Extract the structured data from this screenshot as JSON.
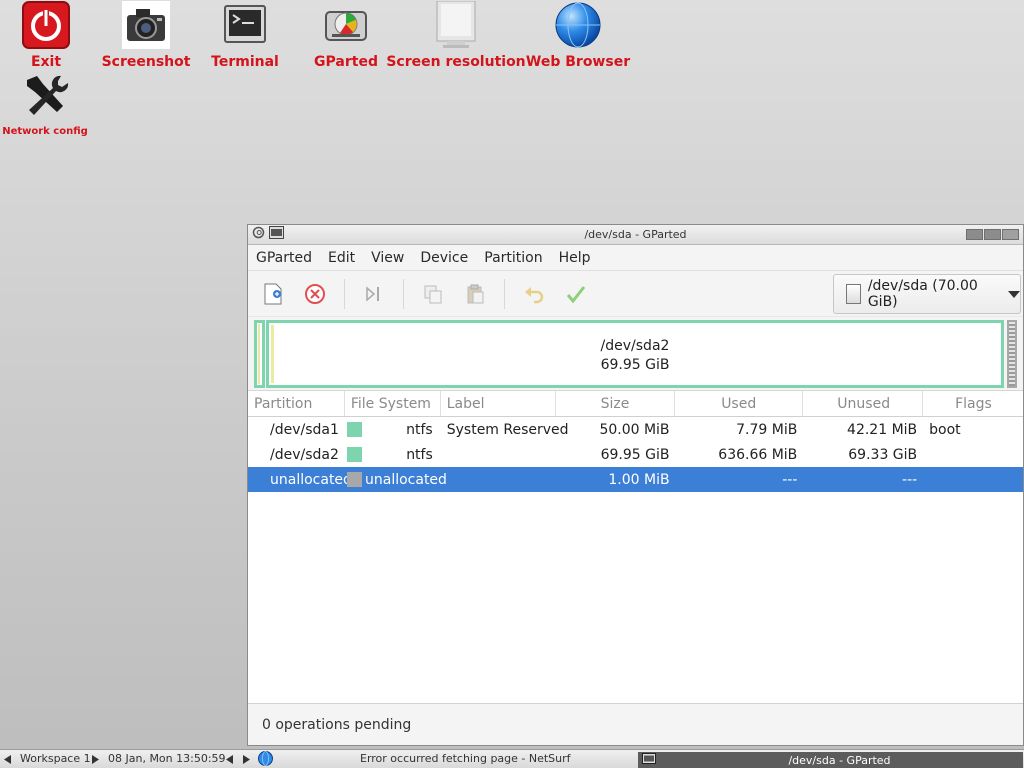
{
  "desktop": {
    "icons": [
      {
        "label": "Exit"
      },
      {
        "label": "Screenshot"
      },
      {
        "label": "Terminal"
      },
      {
        "label": "GParted"
      },
      {
        "label": "Screen resolution"
      },
      {
        "label": "Web Browser"
      },
      {
        "label": "Network config"
      }
    ]
  },
  "window": {
    "title": "/dev/sda - GParted",
    "menu": [
      "GParted",
      "Edit",
      "View",
      "Device",
      "Partition",
      "Help"
    ],
    "device_selector": "/dev/sda  (70.00 GiB)",
    "partition_map": {
      "name": "/dev/sda2",
      "size": "69.95 GiB"
    },
    "columns": [
      "Partition",
      "File System",
      "Label",
      "Size",
      "Used",
      "Unused",
      "Flags"
    ],
    "rows": [
      {
        "partition": "/dev/sda1",
        "fs": "ntfs",
        "fs_color": "#7fd4b0",
        "label": "System Reserved",
        "size": "50.00 MiB",
        "used": "7.79 MiB",
        "unused": "42.21 MiB",
        "flags": "boot"
      },
      {
        "partition": "/dev/sda2",
        "fs": "ntfs",
        "fs_color": "#7fd4b0",
        "label": "",
        "size": "69.95 GiB",
        "used": "636.66 MiB",
        "unused": "69.33 GiB",
        "flags": ""
      },
      {
        "partition": "unallocated",
        "fs": "unallocated",
        "fs_color": "#a8a8a8",
        "label": "",
        "size": "1.00 MiB",
        "used": "---",
        "unused": "---",
        "flags": ""
      }
    ],
    "status": "0 operations pending"
  },
  "taskbar": {
    "workspace": "Workspace 1",
    "datetime": "08 Jan, Mon 13:50:59",
    "message": "Error occurred fetching page - NetSurf",
    "active_window": "/dev/sda - GParted"
  },
  "colors": {
    "selection": "#3b7fd6",
    "ntfs": "#7fd4b0",
    "desktop_label": "#d4131b"
  }
}
